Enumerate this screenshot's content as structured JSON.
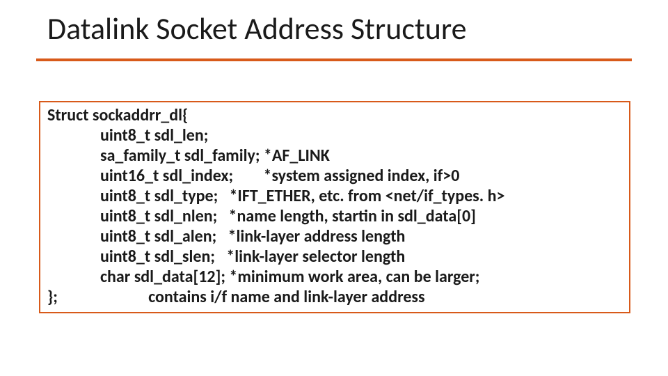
{
  "title": "Datalink Socket Address Structure",
  "code": {
    "open": "Struct sockaddrr_dl{",
    "lines": [
      "uint8_t sdl_len;",
      "sa_family_t sdl_family; *AF_LINK",
      "uint16_t sdl_index;        *system assigned index, if>0",
      "uint8_t sdl_type;   *IFT_ETHER, etc. from <net/if_types. h>",
      "uint8_t sdl_nlen;   *name length, startin in sdl_data[0]",
      "uint8_t sdl_alen;   *link-layer address length",
      "uint8_t sdl_slen;   *link-layer selector length",
      "char sdl_data[12]; *minimum work area, can be larger;"
    ],
    "continuation": "contains i/f name and link-layer address",
    "close": "};"
  }
}
